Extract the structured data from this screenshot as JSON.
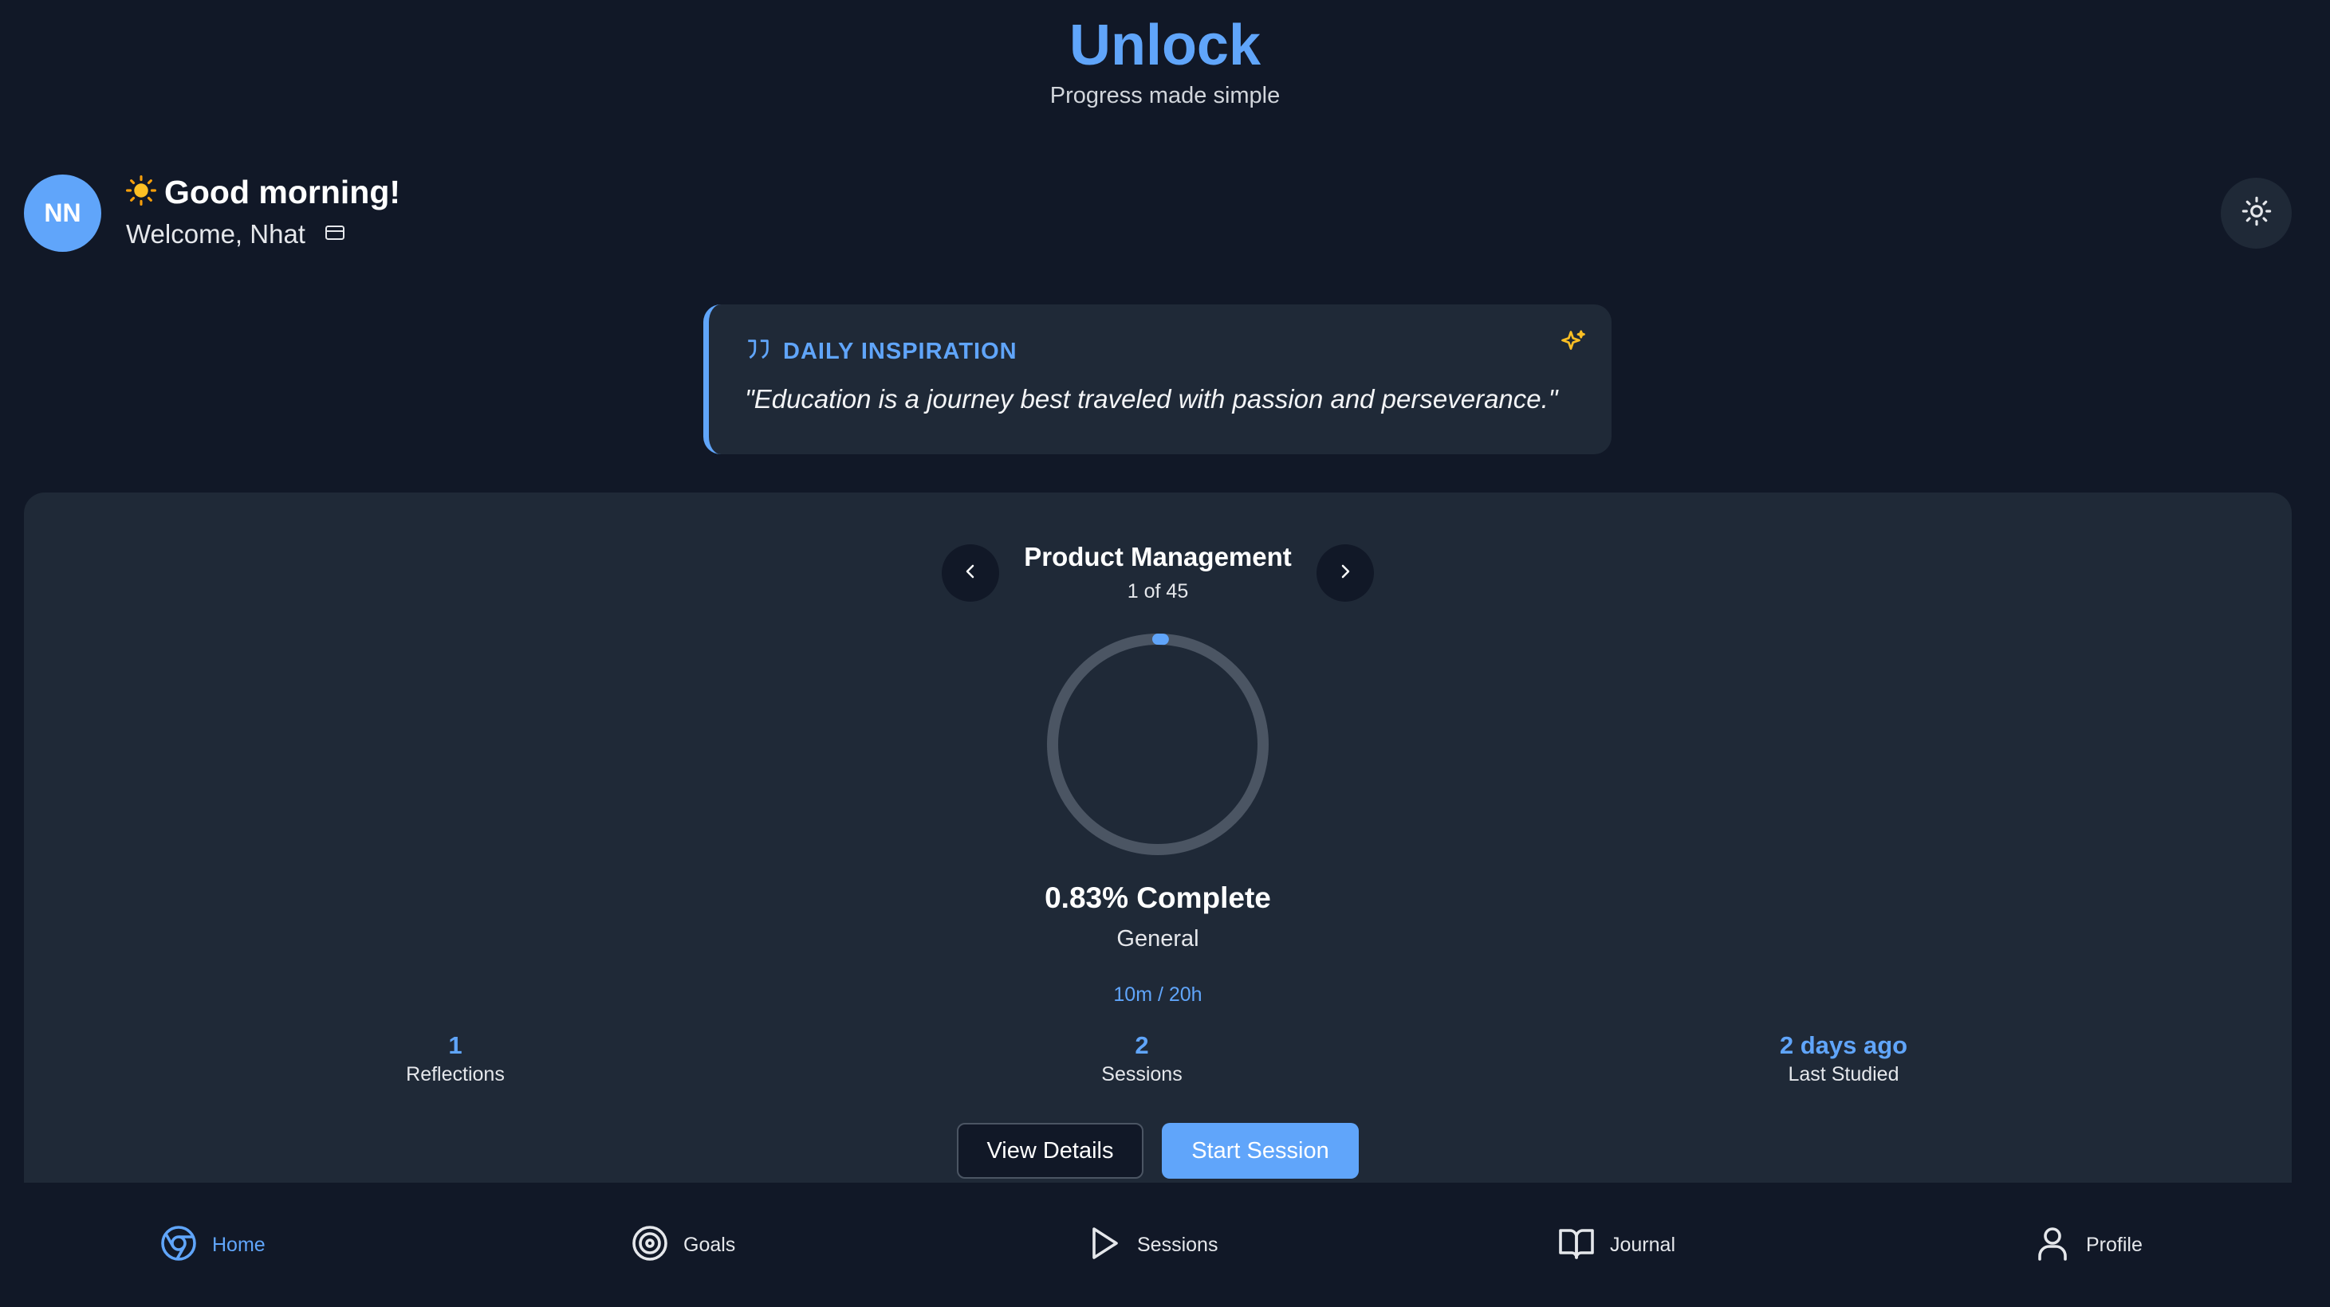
{
  "header": {
    "title": "Unlock",
    "subtitle": "Progress made simple"
  },
  "user": {
    "initials": "NN",
    "greeting": "Good morning!",
    "welcome": "Welcome, Nhat"
  },
  "inspiration": {
    "label": "DAILY INSPIRATION",
    "quote": "\"Education is a journey best traveled with passion and perseverance.\""
  },
  "course": {
    "title": "Product Management",
    "position": "1 of 45",
    "progress_percent": 0.83,
    "complete_text": "0.83% Complete",
    "category": "General",
    "time": "10m / 20h",
    "stats": [
      {
        "value": "1",
        "label": "Reflections"
      },
      {
        "value": "2",
        "label": "Sessions"
      },
      {
        "value": "2 days ago",
        "label": "Last Studied"
      }
    ],
    "view_details_label": "View Details",
    "start_session_label": "Start Session"
  },
  "nav": {
    "items": [
      {
        "label": "Home",
        "icon": "home-icon",
        "active": true
      },
      {
        "label": "Goals",
        "icon": "target-icon",
        "active": false
      },
      {
        "label": "Sessions",
        "icon": "play-icon",
        "active": false
      },
      {
        "label": "Journal",
        "icon": "book-icon",
        "active": false
      },
      {
        "label": "Profile",
        "icon": "user-icon",
        "active": false
      }
    ]
  },
  "colors": {
    "accent": "#60a5fa",
    "background": "#111827",
    "card": "#1f2937",
    "spark": "#fbbf24"
  }
}
